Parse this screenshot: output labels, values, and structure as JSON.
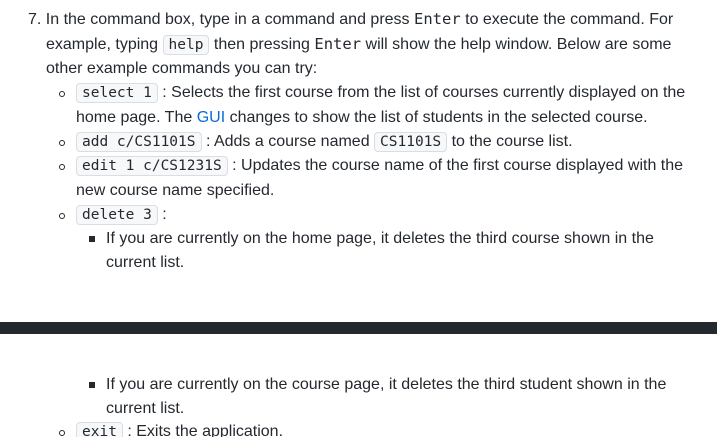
{
  "step": {
    "number": "7.",
    "line1_a": "In the command box, type in a command and press ",
    "key_enter": "Enter",
    "line1_b": " to execute the command. For",
    "line2_a": "example, typing ",
    "help_cmd": "help",
    "line2_b": " then pressing ",
    "line2_c": " will show the help window. Below are some",
    "line3": "other example commands you can try:"
  },
  "commands": {
    "select": {
      "code": "select 1",
      "desc1": " : Selects the first course from the list of courses currently displayed on the",
      "desc2_a": "home page. The ",
      "gui_link": "GUI",
      "desc2_b": " changes to show the list of students in the selected course."
    },
    "add": {
      "code": "add c/CS1101S",
      "desc_a": " : Adds a course named ",
      "course_code": "CS1101S",
      "desc_b": " to the course list."
    },
    "edit": {
      "code": "edit 1 c/CS1231S",
      "desc1": " : Updates the course name of the first course displayed with the",
      "desc2": "new course name specified."
    },
    "delete": {
      "code": "delete 3",
      "desc": " :",
      "sub1_line1": "If you are currently on the home page, it deletes the third course shown in the",
      "sub1_line2": "current list.",
      "sub2_line1": "If you are currently on the course page, it deletes the third student shown in the",
      "sub2_line2": "current list."
    },
    "exit": {
      "code": "exit",
      "desc": " : Exits the application."
    }
  },
  "colors": {
    "link": "#0969da",
    "page_break": "#24292e"
  }
}
